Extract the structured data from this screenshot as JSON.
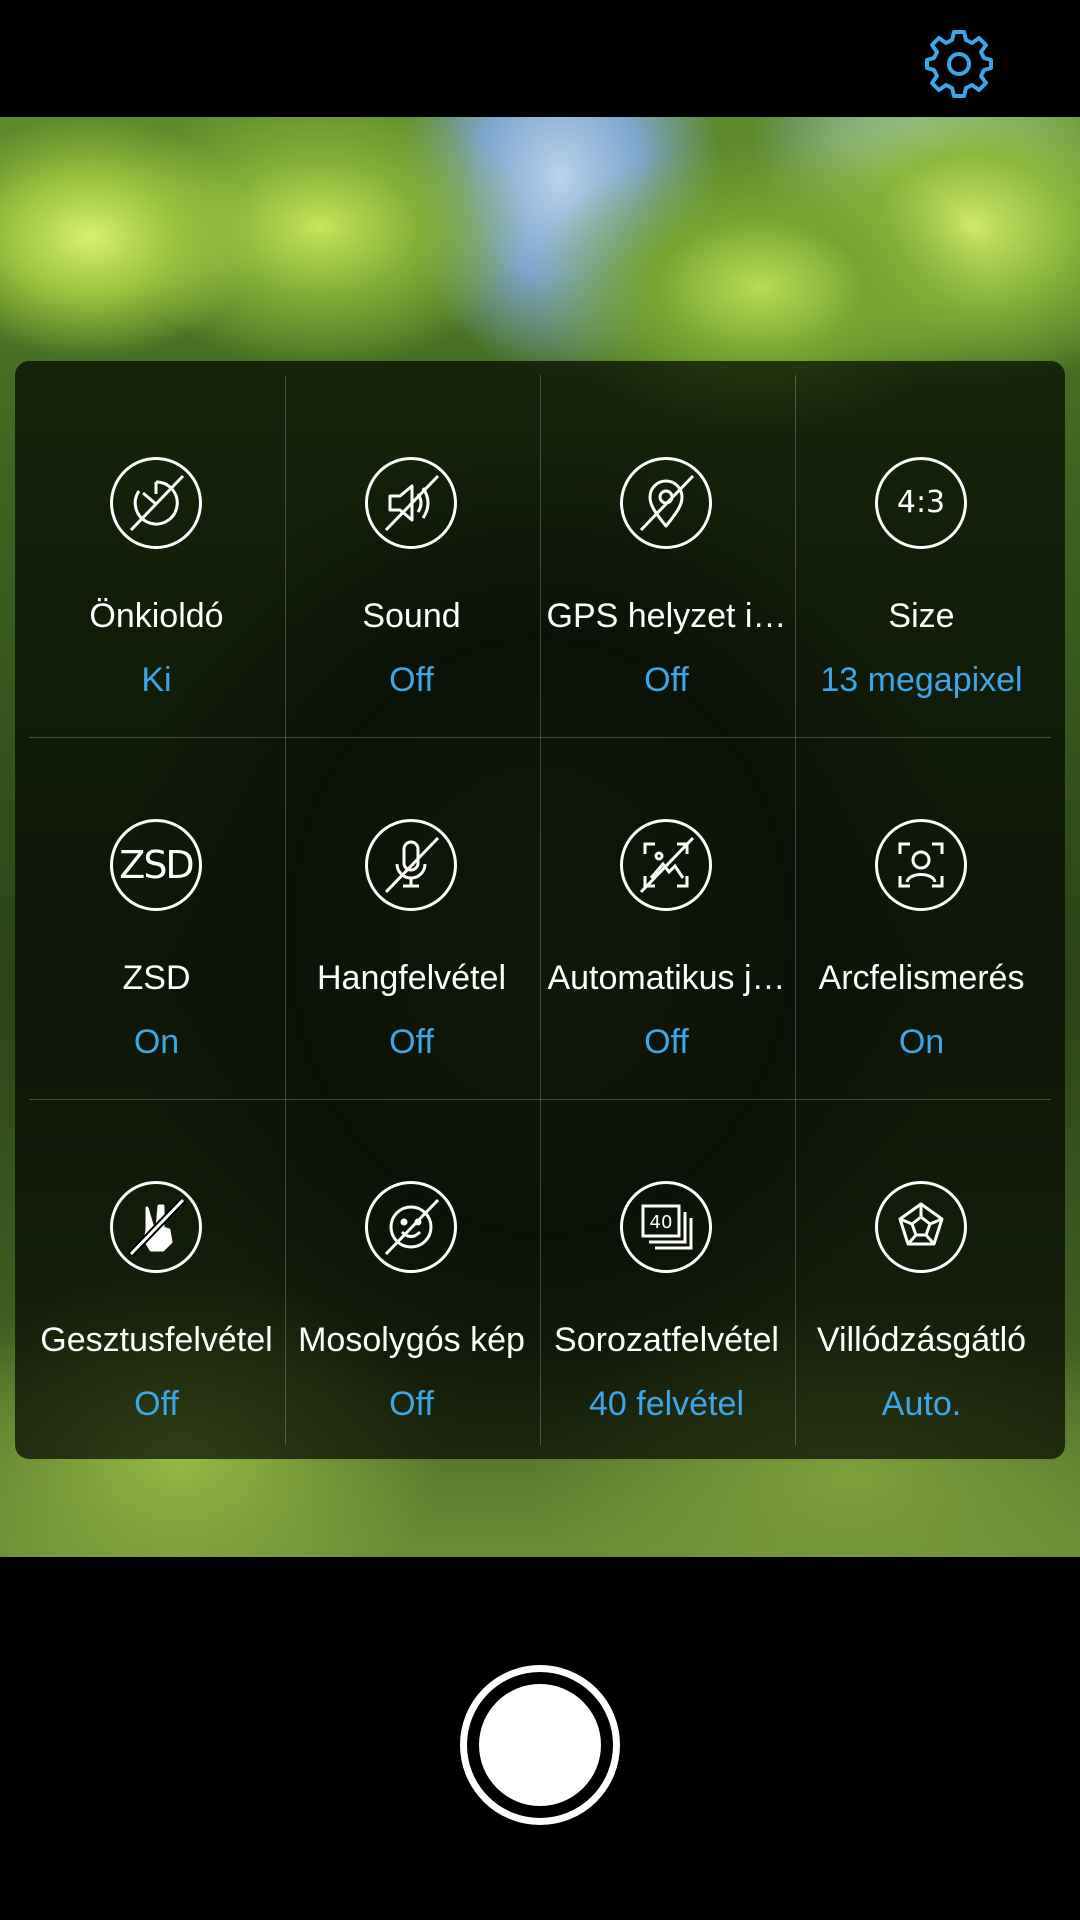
{
  "top_bar": {
    "settings_icon": "gear-icon",
    "accent_color": "#3ea6e6"
  },
  "settings": [
    {
      "label": "Önkioldó",
      "value": "Ki",
      "icon": "self-timer-off-icon"
    },
    {
      "label": "Sound",
      "value": "Off",
      "icon": "sound-off-icon"
    },
    {
      "label": "GPS helyzet i…",
      "value": "Off",
      "icon": "gps-location-off-icon"
    },
    {
      "label": "Size",
      "value": "13 megapixel",
      "icon": "aspect-ratio-icon",
      "icon_text": "4:3"
    },
    {
      "label": "ZSD",
      "value": "On",
      "icon": "zsd-icon",
      "icon_text": "ZSD"
    },
    {
      "label": "Hangfelvétel",
      "value": "Off",
      "icon": "microphone-off-icon"
    },
    {
      "label": "Automatikus j…",
      "value": "Off",
      "icon": "auto-scene-off-icon"
    },
    {
      "label": "Arcfelismerés",
      "value": "On",
      "icon": "face-detection-icon"
    },
    {
      "label": "Gesztusfelvétel",
      "value": "Off",
      "icon": "gesture-shot-off-icon"
    },
    {
      "label": "Mosolygós kép",
      "value": "Off",
      "icon": "smile-shot-off-icon"
    },
    {
      "label": "Sorozatfelvétel",
      "value": "40 felvétel",
      "icon": "burst-shot-icon",
      "icon_text": "40"
    },
    {
      "label": "Villódzásgátló",
      "value": "Auto.",
      "icon": "anti-flicker-icon"
    }
  ],
  "shutter": {
    "icon": "shutter-button-icon"
  }
}
